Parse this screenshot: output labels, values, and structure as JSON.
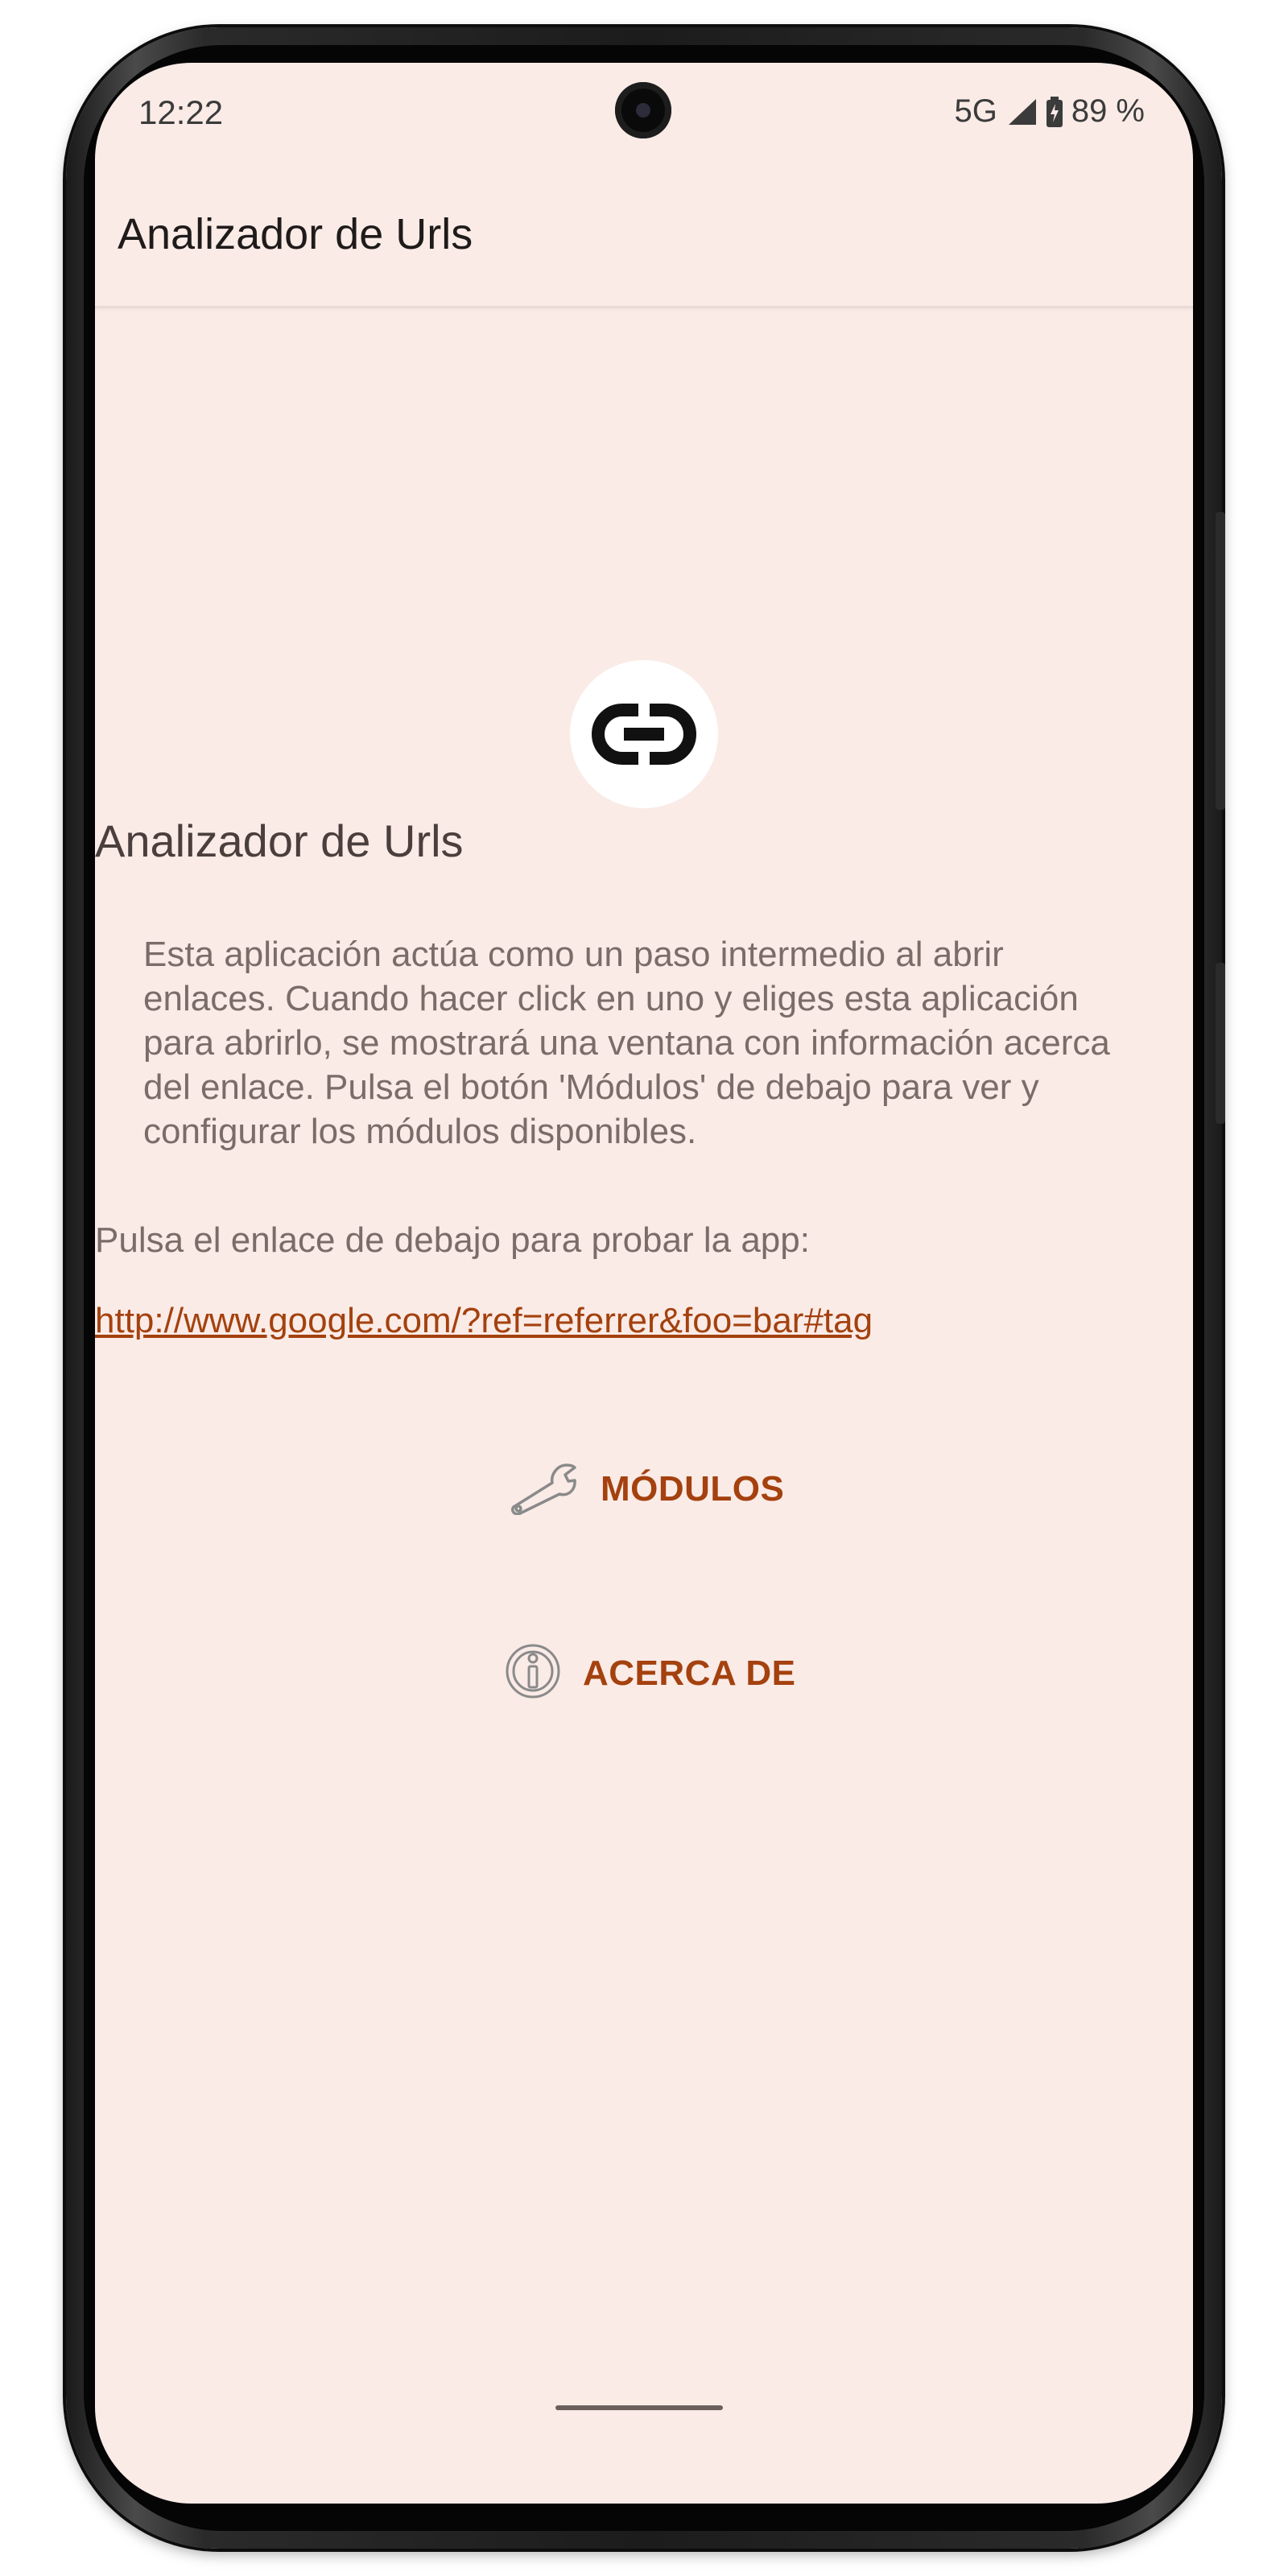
{
  "status_bar": {
    "time": "12:22",
    "network": "5G",
    "battery": "89 %"
  },
  "app_bar": {
    "title": "Analizador de Urls"
  },
  "main": {
    "logo_icon": "link-icon",
    "app_name": "Analizador de Urls",
    "description": "Esta aplicación actúa como un paso intermedio al abrir enlaces. Cuando hacer click en uno y eliges esta aplicación para abrirlo, se mostrará una ventana con información acerca del enlace. Pulsa el botón 'Módulos' de debajo para ver y configurar los módulos disponibles.",
    "try_label": "Pulsa el enlace de debajo para probar la app:",
    "test_link": "http://www.google.com/?ref=referrer&foo=bar#tag",
    "buttons": {
      "modules": {
        "label": "MÓDULOS",
        "icon": "wrench-icon"
      },
      "about": {
        "label": "ACERCA DE",
        "icon": "info-icon"
      }
    }
  },
  "colors": {
    "background": "#faebe7",
    "accent": "#a4410e",
    "text_primary": "#1f1b1a",
    "text_secondary": "#7a6c68"
  }
}
